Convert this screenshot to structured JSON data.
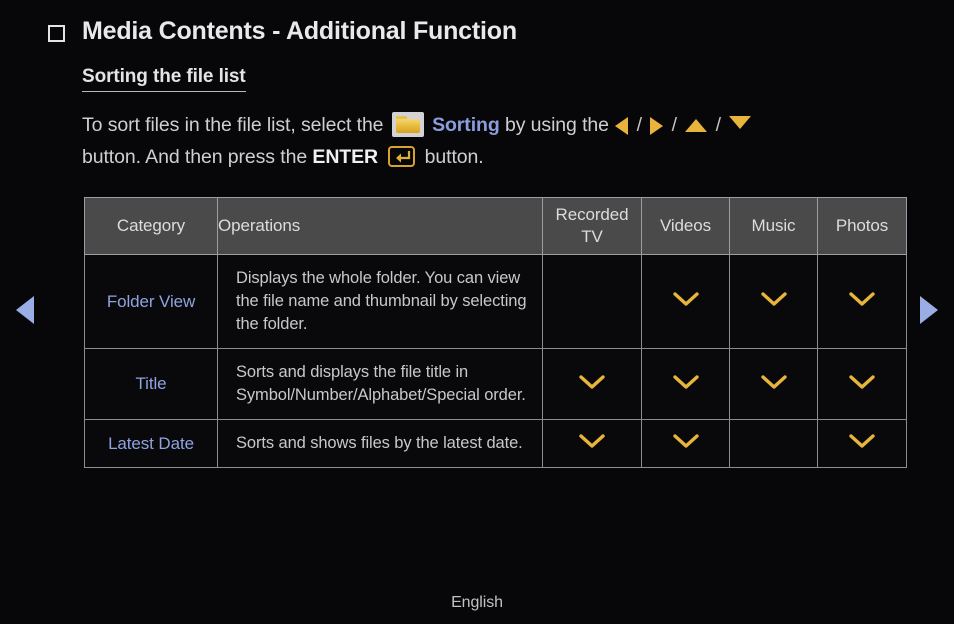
{
  "header": {
    "bullet_icon": "square-bullet-icon",
    "title": "Media Contents - Additional Function"
  },
  "section": {
    "heading": "Sorting the file list"
  },
  "paragraph": {
    "part1": "To sort files in the file list, select the",
    "folder_icon": "folder-icon",
    "keyword_sorting": "Sorting",
    "part2": "by using the",
    "arrow_left_icon": "arrow-left-icon",
    "arrow_right_icon": "arrow-right-icon",
    "arrow_up_icon": "arrow-up-icon",
    "arrow_down_icon": "arrow-down-icon",
    "separator": "/",
    "part3": "button. And then press the",
    "keyword_enter": "ENTER",
    "enter_icon": "enter-key-icon",
    "part4": "button."
  },
  "table": {
    "columns": [
      {
        "label": "Category",
        "key": "category"
      },
      {
        "label": "Operations",
        "key": "operations"
      },
      {
        "label": "Recorded TV",
        "label_line1": "Recorded",
        "label_line2": "TV",
        "key": "recorded_tv"
      },
      {
        "label": "Videos",
        "key": "videos"
      },
      {
        "label": "Music",
        "key": "music"
      },
      {
        "label": "Photos",
        "key": "photos"
      }
    ],
    "rows": [
      {
        "category": "Folder View",
        "operations": "Displays the whole folder. You can view the file name and thumbnail by selecting the folder.",
        "recorded_tv": false,
        "videos": true,
        "music": true,
        "photos": true
      },
      {
        "category": "Title",
        "operations": "Sorts and displays the file title in Symbol/Number/Alphabet/Special order.",
        "recorded_tv": true,
        "videos": true,
        "music": true,
        "photos": true
      },
      {
        "category": "Latest Date",
        "operations": "Sorts and shows files by the latest date.",
        "recorded_tv": true,
        "videos": true,
        "music": false,
        "photos": true
      }
    ],
    "mark_icon": "chevron-down-icon"
  },
  "navigation": {
    "prev_icon": "nav-prev-arrow-icon",
    "next_icon": "nav-next-arrow-icon"
  },
  "footer": {
    "language": "English"
  },
  "colors": {
    "background": "#070709",
    "text": "#cfcfd2",
    "accent_blue": "#8fa3de",
    "accent_gold": "#e8b43c",
    "header_bg": "#4a4a4a",
    "border": "#9d9da2",
    "nav_arrow": "#9aade4"
  }
}
